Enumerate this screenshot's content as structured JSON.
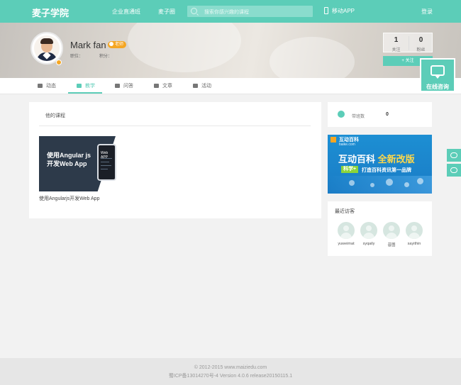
{
  "header": {
    "logo": "麦子学院",
    "nav": [
      "企业直通班",
      "麦子圈"
    ],
    "search_placeholder": "搜索你感兴趣的课程",
    "app_label": "移动APP",
    "login": "登录"
  },
  "profile": {
    "name": "Mark fan",
    "role_badge": "老师",
    "position_label": "职位：",
    "points_label": "积分：",
    "stats": [
      {
        "value": "1",
        "label": "关注"
      },
      {
        "value": "0",
        "label": "粉丝"
      }
    ],
    "follow_button": "+ 关注"
  },
  "consult": {
    "label": "在线咨询"
  },
  "tabs": [
    "动态",
    "教学",
    "问答",
    "文章",
    "活动"
  ],
  "active_tab": "教学",
  "main": {
    "section_title": "他的课程",
    "courses": [
      {
        "thumb_line1": "使用Angular js",
        "thumb_line2": "开发Web App",
        "thumb_phone_text": "Web APP",
        "title": "使用Angularjs开发Web App"
      }
    ]
  },
  "sidebar": {
    "classes_label": "带班数",
    "classes_value": "0",
    "ad": {
      "brand": "互动百科",
      "brand_domain": "baike.com",
      "headline_a": "互动百科 ",
      "headline_b": "全新改版",
      "tag": "科学+",
      "sub": "打造百科资讯第一品牌"
    },
    "visitors_title": "最近访客",
    "visitors": [
      "yuweimat",
      "syqaily",
      "昔图",
      "sayithin"
    ]
  },
  "footer": {
    "line1": "© 2012-2015 www.maiziedu.com",
    "line2": "蜀ICP备13014270号-4 Version 4.0.6 release20150115.1"
  },
  "colors": {
    "accent": "#5ccdb8",
    "badge": "#f5a623",
    "ad_blue": "#1d8fd3"
  }
}
